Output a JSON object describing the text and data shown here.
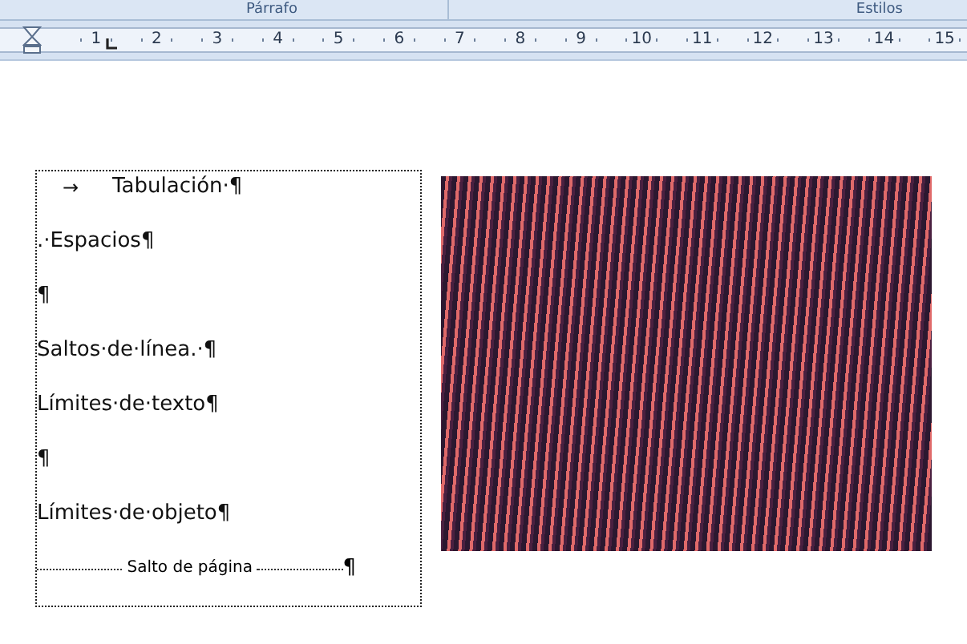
{
  "ribbon": {
    "group_labels": [
      "Párrafo",
      "Estilos"
    ]
  },
  "ruler": {
    "numbers": [
      "1",
      "2",
      "3",
      "4",
      "5",
      "6",
      "7",
      "8",
      "9",
      "10",
      "11",
      "12",
      "13",
      "14",
      "15"
    ]
  },
  "text_box": {
    "paragraphs": [
      {
        "kind": "tab",
        "mark": "→",
        "text": "Tabulación·¶"
      },
      {
        "kind": "text",
        "text": ".·Espacios¶"
      },
      {
        "kind": "text",
        "text": "¶"
      },
      {
        "kind": "text",
        "text": "Saltos·de·línea.·¶"
      },
      {
        "kind": "text",
        "text": "Límites·de·texto¶"
      },
      {
        "kind": "text",
        "text": "¶"
      },
      {
        "kind": "text",
        "text": "Límites·de·objeto¶"
      },
      {
        "kind": "page_break",
        "text": "Salto de página",
        "mark": "¶"
      }
    ]
  }
}
